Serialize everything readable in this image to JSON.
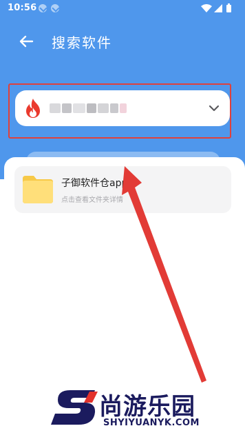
{
  "status_bar": {
    "time": "10:56",
    "notification_icons": [
      "download-icon",
      "download-icon"
    ],
    "right_icons": [
      "wifi-icon",
      "signal-icon",
      "battery-icon"
    ]
  },
  "header": {
    "back_icon": "arrow-left-icon",
    "title": "搜索软件"
  },
  "source_selector": {
    "icon": "fire-icon",
    "name": "",
    "name_obscured": true,
    "dropdown_icon": "chevron-down-icon"
  },
  "results": [
    {
      "icon": "folder-icon",
      "name": "子御软件仓app",
      "subtitle": "点击查看文件夹详情"
    }
  ],
  "watermark": {
    "chinese": "尚游乐园",
    "english": "SHYIYUANYK.COM"
  },
  "colors": {
    "primary": "#4f97ec",
    "highlight_red": "#e0413b",
    "card_bg": "#f4f4f5",
    "folder_yellow": "#ffd96b",
    "watermark_navy": "#1b1b5e"
  }
}
